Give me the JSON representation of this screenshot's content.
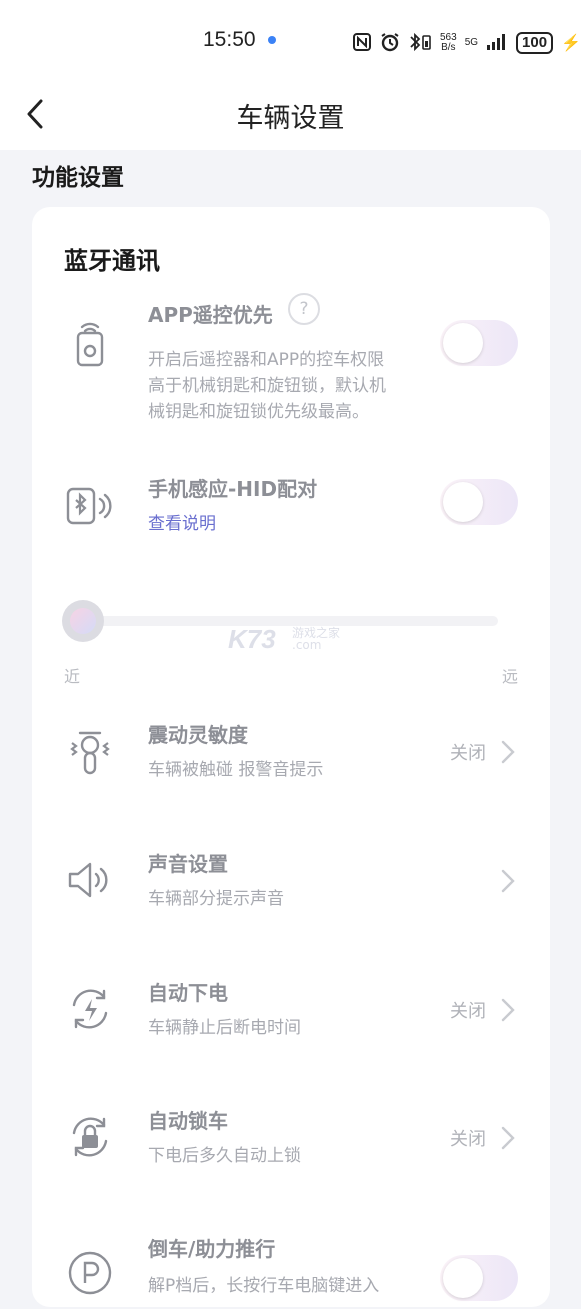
{
  "status_bar": {
    "time": "15:50",
    "net_speed_value": "563",
    "net_speed_unit": "B/s",
    "net_type": "5G",
    "battery": "100"
  },
  "header": {
    "title": "车辆设置"
  },
  "section": {
    "title": "功能设置"
  },
  "card": {
    "title": "蓝牙通讯",
    "app_remote": {
      "label": "APP遥控优先",
      "help_symbol": "?",
      "desc_line1": "开启后遥控器和APP的控车权限",
      "desc_line2": "高于机械钥匙和旋钮锁，默认机",
      "desc_line3": "械钥匙和旋钮锁优先级最高。",
      "enabled": false
    },
    "hid_pairing": {
      "label": "手机感应-HID配对",
      "link": "查看说明",
      "enabled": false
    },
    "range_slider": {
      "min_label": "近",
      "max_label": "远",
      "value_fraction": 0.0
    },
    "vibration": {
      "label": "震动灵敏度",
      "desc": "车辆被触碰 报警音提示",
      "value": "关闭"
    },
    "sound": {
      "label": "声音设置",
      "desc": "车辆部分提示声音"
    },
    "auto_power_off": {
      "label": "自动下电",
      "desc": "车辆静止后断电时间",
      "value": "关闭"
    },
    "auto_lock": {
      "label": "自动锁车",
      "desc": "下电后多久自动上锁",
      "value": "关闭"
    },
    "reverse_assist": {
      "label": "倒车/助力推行",
      "desc": "解P档后，长按行车电脑键进入",
      "enabled": false
    }
  },
  "watermark": {
    "brand": "K73",
    "site": "游戏之家",
    "domain": ".com"
  },
  "colors": {
    "page_bg": "#f3f4f8",
    "card_bg": "#ffffff",
    "link": "#6a6fcf",
    "muted_text": "#8d8f96"
  }
}
